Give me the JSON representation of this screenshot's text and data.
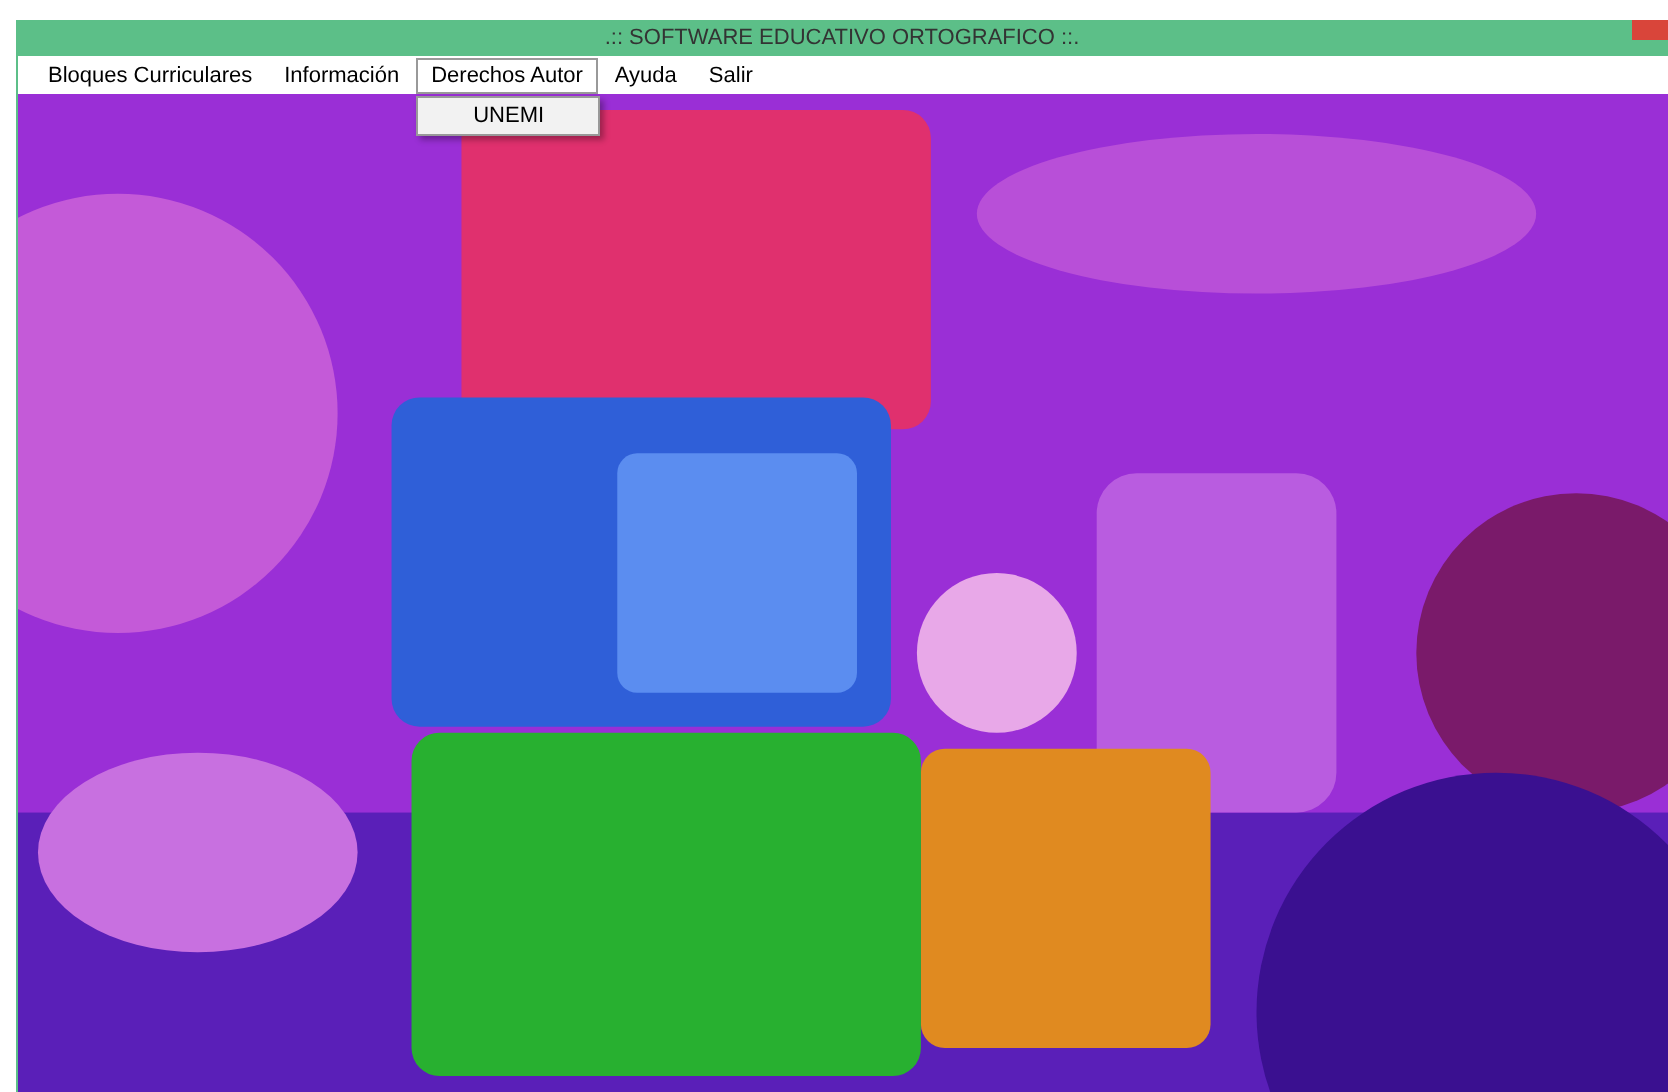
{
  "window": {
    "title": ".:: SOFTWARE EDUCATIVO ORTOGRAFICO ::."
  },
  "menu": [
    {
      "label": "Bloques Curriculares",
      "selected": false
    },
    {
      "label": "Información",
      "selected": false
    },
    {
      "label": "Derechos Autor",
      "selected": true,
      "dropdown": [
        "UNEMI"
      ]
    },
    {
      "label": "Ayuda",
      "selected": false
    },
    {
      "label": "Salir",
      "selected": false
    }
  ]
}
